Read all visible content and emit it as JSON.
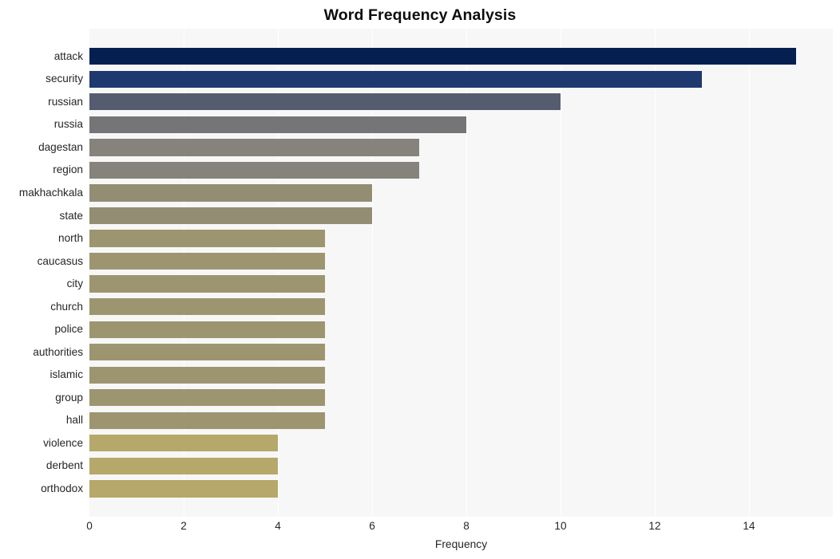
{
  "chart_data": {
    "type": "bar",
    "orientation": "horizontal",
    "title": "Word Frequency Analysis",
    "xlabel": "Frequency",
    "ylabel": "",
    "categories": [
      "attack",
      "security",
      "russian",
      "russia",
      "dagestan",
      "region",
      "makhachkala",
      "state",
      "north",
      "caucasus",
      "city",
      "church",
      "police",
      "authorities",
      "islamic",
      "group",
      "hall",
      "violence",
      "derbent",
      "orthodox"
    ],
    "values": [
      15,
      13,
      10,
      8,
      7,
      7,
      6,
      6,
      5,
      5,
      5,
      5,
      5,
      5,
      5,
      5,
      5,
      4,
      4,
      4
    ],
    "bar_colors": [
      "#042050",
      "#1e3870",
      "#565c70",
      "#757578",
      "#85837c",
      "#85837c",
      "#938d74",
      "#938d74",
      "#9d9570",
      "#9d9570",
      "#9d9570",
      "#9d9570",
      "#9d9570",
      "#9d9570",
      "#9d9570",
      "#9d9570",
      "#9d9570",
      "#b5a86a",
      "#b5a86a",
      "#b5a86a"
    ],
    "xlim": [
      0,
      15.78
    ],
    "xticks": [
      0,
      2,
      4,
      6,
      8,
      10,
      12,
      14
    ],
    "xtick_labels": [
      "0",
      "2",
      "4",
      "6",
      "8",
      "10",
      "12",
      "14"
    ],
    "grid": true,
    "grid_axis": "x",
    "legend": null,
    "plot_background": "#f7f7f7",
    "figure_background": "#ffffff",
    "gridline_color": "#ffffff",
    "tick_label_color": "#262626",
    "title_color": "#0d0d0d"
  }
}
